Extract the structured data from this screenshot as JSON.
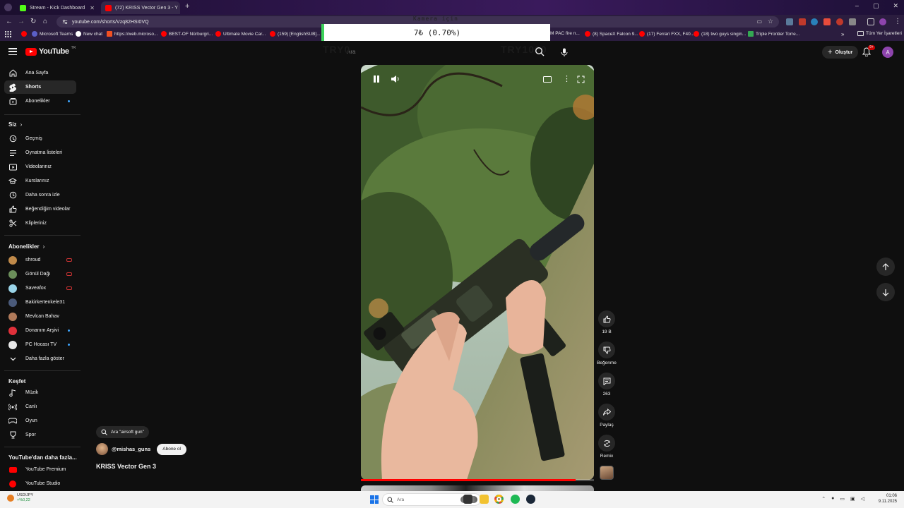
{
  "browser": {
    "tabs": [
      {
        "title": "Stream - Kick Dashboard",
        "active": false,
        "favicon_color": "#53fc18"
      },
      {
        "title": "(72) KRISS Vector Gen 3 - Y",
        "active": true,
        "favicon_color": "#ff0000"
      }
    ],
    "url": "youtube.com/shorts/Vzq82HSI0VQ",
    "bookmarks": [
      {
        "label": "Microsoft Teams",
        "color": "#5b5fc7"
      },
      {
        "label": "New chat",
        "color": "#ffffff"
      },
      {
        "label": "https://web.microso...",
        "color": "#f25022"
      },
      {
        "label": "BEST-OF Nürburgri...",
        "color": "#ff0000"
      },
      {
        "label": "Ultimate Movie Car...",
        "color": "#ff0000"
      },
      {
        "label": "(159) [EnglishSUB]...",
        "color": "#ff0000"
      },
      {
        "label": "M PAC fire n...",
        "color": "#ff0000"
      },
      {
        "label": "(8) SpaceX Falcon 9...",
        "color": "#ff0000"
      },
      {
        "label": "(17) Ferrari FXX, F40...",
        "color": "#ff0000"
      },
      {
        "label": "(18) two guys singin...",
        "color": "#ff0000"
      },
      {
        "label": "Triple Frontier Torre...",
        "color": "#34a853"
      }
    ],
    "bookmarks_more": "»",
    "all_bookmarks": "Tüm Yer İşaretleri"
  },
  "overlay": {
    "title": "Kamera için",
    "value": "7₺ (0.70%)",
    "ghost_left": "TRY0",
    "ghost_right": "TRY1000"
  },
  "header": {
    "logo_text": "YouTube",
    "logo_region": "TR",
    "search_placeholder": "Ara",
    "create_label": "Oluştur",
    "notifications": "9+",
    "avatar_letter": "A"
  },
  "sidebar": {
    "main": [
      {
        "label": "Ana Sayfa",
        "icon": "home-icon"
      },
      {
        "label": "Shorts",
        "icon": "shorts-icon",
        "active": true
      },
      {
        "label": "Abonelikler",
        "icon": "subscriptions-icon"
      }
    ],
    "you_heading": "Siz",
    "you_items": [
      {
        "label": "Geçmiş",
        "icon": "history-icon"
      },
      {
        "label": "Oynatma listeleri",
        "icon": "playlists-icon"
      },
      {
        "label": "Videolarınız",
        "icon": "your-videos-icon"
      },
      {
        "label": "Kurslarınız",
        "icon": "courses-icon"
      },
      {
        "label": "Daha sonra izle",
        "icon": "watch-later-icon"
      },
      {
        "label": "Beğendiğim videolar",
        "icon": "liked-icon"
      },
      {
        "label": "Klipleriniz",
        "icon": "clips-icon"
      }
    ],
    "subs_heading": "Abonelikler",
    "subs_items": [
      {
        "label": "shroud",
        "color": "#c08a4a",
        "badge": "live"
      },
      {
        "label": "Gönül Dağı",
        "color": "#6b8e5a",
        "badge": "live"
      },
      {
        "label": "Saveafox",
        "color": "#9ad4e8",
        "badge": "live"
      },
      {
        "label": "Bakirkertenkele31",
        "color": "#4a5a7a",
        "badge": "none"
      },
      {
        "label": "Mevlcan Bahav",
        "color": "#b07a5a",
        "badge": "none"
      },
      {
        "label": "Donanım Arşivi",
        "color": "#e0303a",
        "badge": "dot"
      },
      {
        "label": "PC Hocası TV",
        "color": "#e8e8e8",
        "badge": "dot"
      }
    ],
    "show_more": "Daha fazla göster",
    "explore_heading": "Keşfet",
    "explore_items": [
      {
        "label": "Müzik",
        "icon": "music-icon"
      },
      {
        "label": "Canlı",
        "icon": "live-icon"
      },
      {
        "label": "Oyun",
        "icon": "gaming-icon"
      },
      {
        "label": "Spor",
        "icon": "sports-icon"
      }
    ],
    "more_heading": "YouTube'dan daha fazla...",
    "more_items": [
      {
        "label": "YouTube Premium",
        "icon": "youtube-premium-icon"
      },
      {
        "label": "YouTube Studio",
        "icon": "youtube-studio-icon"
      }
    ]
  },
  "short": {
    "search_chip": "Ara \"airsoft gun\"",
    "channel": "@mishas_guns",
    "subscribe_label": "Abone ol",
    "title": "KRISS Vector Gen 3",
    "progress": 0.92,
    "actions": [
      {
        "label": "19 B",
        "icon": "like-icon"
      },
      {
        "label": "Beğenme",
        "icon": "dislike-icon"
      },
      {
        "label": "263",
        "icon": "comments-icon"
      },
      {
        "label": "Paylaş",
        "icon": "share-icon"
      },
      {
        "label": "Remix",
        "icon": "remix-icon"
      }
    ]
  },
  "taskbar": {
    "widget_title": "USD/JPY",
    "widget_change": "+%0,22",
    "search_placeholder": "Ara",
    "time": "01:06",
    "date": "9.11.2025"
  }
}
